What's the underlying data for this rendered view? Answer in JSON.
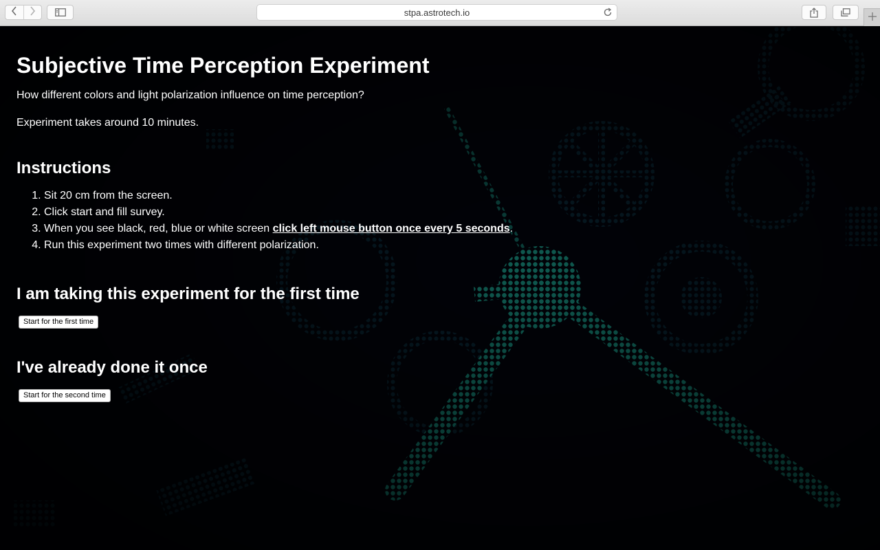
{
  "browser": {
    "url": "stpa.astrotech.io"
  },
  "page": {
    "title": "Subjective Time Perception Experiment",
    "subtitle": "How different colors and light polarization influence on time perception?",
    "duration": "Experiment takes around 10 minutes.",
    "instructions_heading": "Instructions",
    "instructions": {
      "item1": "Sit 20 cm from the screen.",
      "item2": "Click start and fill survey.",
      "item3_prefix": "When you see black, red, blue or white screen ",
      "item3_emphasis": "click left mouse button once every 5 seconds",
      "item3_suffix": ".",
      "item4": "Run this experiment two times with different polarization."
    },
    "first_heading": "I am taking this experiment for the first time",
    "first_button": "Start for the first time",
    "second_heading": "I've already done it once",
    "second_button": "Start for the second time"
  },
  "colors": {
    "page_background": "#020308",
    "background_art": "#0f5a50",
    "text": "#ffffff"
  },
  "icons": {
    "back": "chevron-left-icon",
    "forward": "chevron-right-icon",
    "sidebar": "sidebar-icon",
    "reload": "reload-icon",
    "share": "share-icon",
    "tabs": "tabs-overview-icon",
    "new_tab": "plus-icon"
  }
}
